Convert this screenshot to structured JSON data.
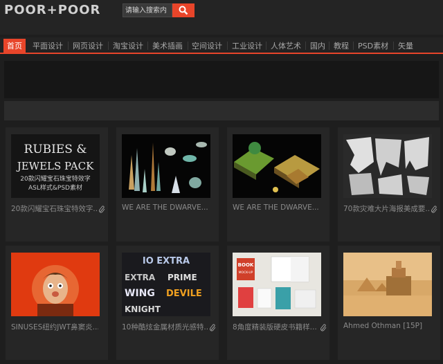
{
  "header": {
    "logo": "POOR+POOR",
    "search_placeholder": "请输入搜索内"
  },
  "nav": {
    "items": [
      "首页",
      "平面设计",
      "网页设计",
      "淘宝设计",
      "美术插画",
      "空间设计",
      "工业设计",
      "人体艺术",
      "国内",
      "教程",
      "PSD素材",
      "矢量"
    ]
  },
  "cards": [
    {
      "title": "20款闪耀宝石珠宝特效字...",
      "thumb_text": [
        "RUBIES &",
        "JEWELS PACK",
        "20款闪耀宝石珠宝特效字",
        "ASL样式&PSD素材"
      ],
      "has_attachment": true
    },
    {
      "title": "WE ARE THE DWARVE...",
      "has_attachment": false
    },
    {
      "title": "WE ARE THE DWARVE...",
      "has_attachment": false
    },
    {
      "title": "70款灾难大片海报美成要...",
      "has_attachment": true
    },
    {
      "title": "SINUSES纽约JWT鼻窦炎...",
      "has_attachment": false
    },
    {
      "title": "10种酷炫金属材质光感特...",
      "thumb_text": [
        "IO EXTRA",
        "EXTRA",
        "PRIME",
        "WING",
        "DEVILE",
        "KNIGHT"
      ],
      "has_attachment": true
    },
    {
      "title": "8角度精装版硬皮书籍样...",
      "thumb_text": [
        "BOOK",
        "MOCK-UP"
      ],
      "has_attachment": true
    },
    {
      "title": "Ahmed Othman [15P]",
      "has_attachment": false
    }
  ],
  "colors": {
    "accent": "#e8452a",
    "background": "#1e1e1e",
    "card": "#262626"
  }
}
